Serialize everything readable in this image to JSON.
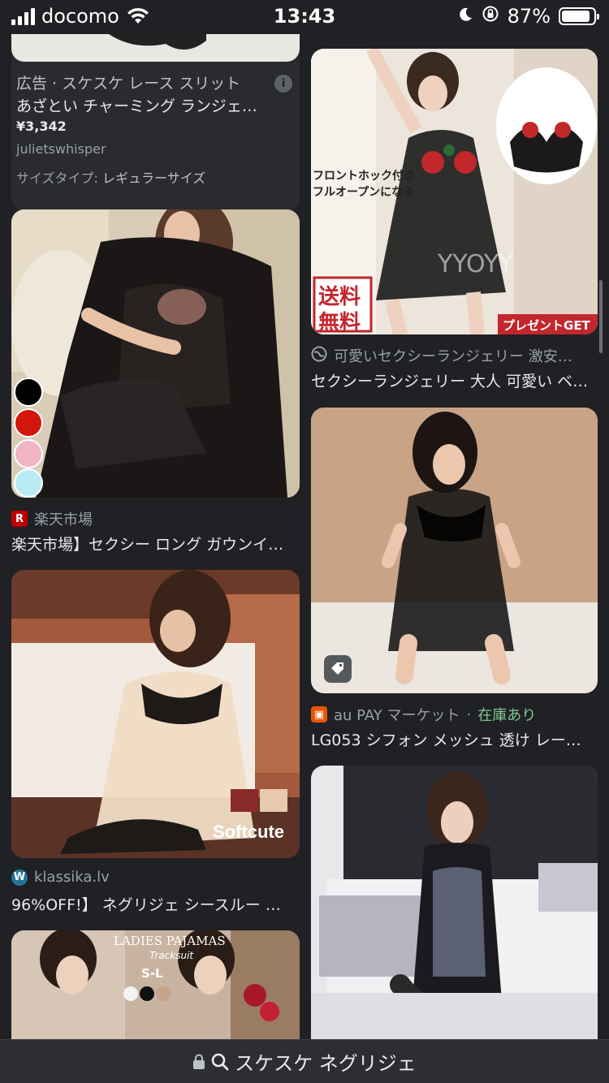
{
  "status_bar": {
    "carrier": "docomo",
    "time": "13:43",
    "battery": "87%"
  },
  "ad": {
    "label": "広告 · スケスケ レース スリット",
    "line2": "あざとい チャーミング ランジェ…",
    "price": "¥3,342",
    "seller": "julietswhisper",
    "size_label": "サイズタイプ:",
    "size_value": "レギュラーサイズ",
    "info": "i"
  },
  "results": [
    {
      "source": "楽天市場",
      "source_icon": "R",
      "title": "楽天市場】セクシー ロング ガウンイ…"
    },
    {
      "source": "klassika.lv",
      "source_icon": "W",
      "title": "96%OFF!】 ネグリジェ シースルー …",
      "overlay": "Softcute"
    },
    {
      "source": "可愛いセクシーランジェリー 激安…",
      "title": "セクシーランジェリー 大人 可愛い ベ…",
      "overlay_lines": [
        "フロントホック付き",
        "フルオープンになる"
      ],
      "overlay_badge": [
        "送料",
        "無料"
      ],
      "overlay_banner": "プレゼントGET",
      "watermark": "YYOYY"
    },
    {
      "source": "au PAY マーケット",
      "source_sep": "·",
      "stock": "在庫あり",
      "source_icon": "▣",
      "title": "LG053 シフォン メッシュ 透け レー…"
    }
  ],
  "pajama_banner": {
    "line1": "LADIES PAJAMAS",
    "line2": "Tracksuit",
    "line3": "S-L"
  },
  "bottom_bar": {
    "query": "スケスケ ネグリジェ"
  },
  "colors": {
    "background": "#202124",
    "text": "#e8eaed",
    "muted": "#9aa0a6",
    "stock_green": "#81c995",
    "rakuten_red": "#bf0000",
    "au_orange": "#eb5505",
    "wp_blue": "#21759b"
  }
}
